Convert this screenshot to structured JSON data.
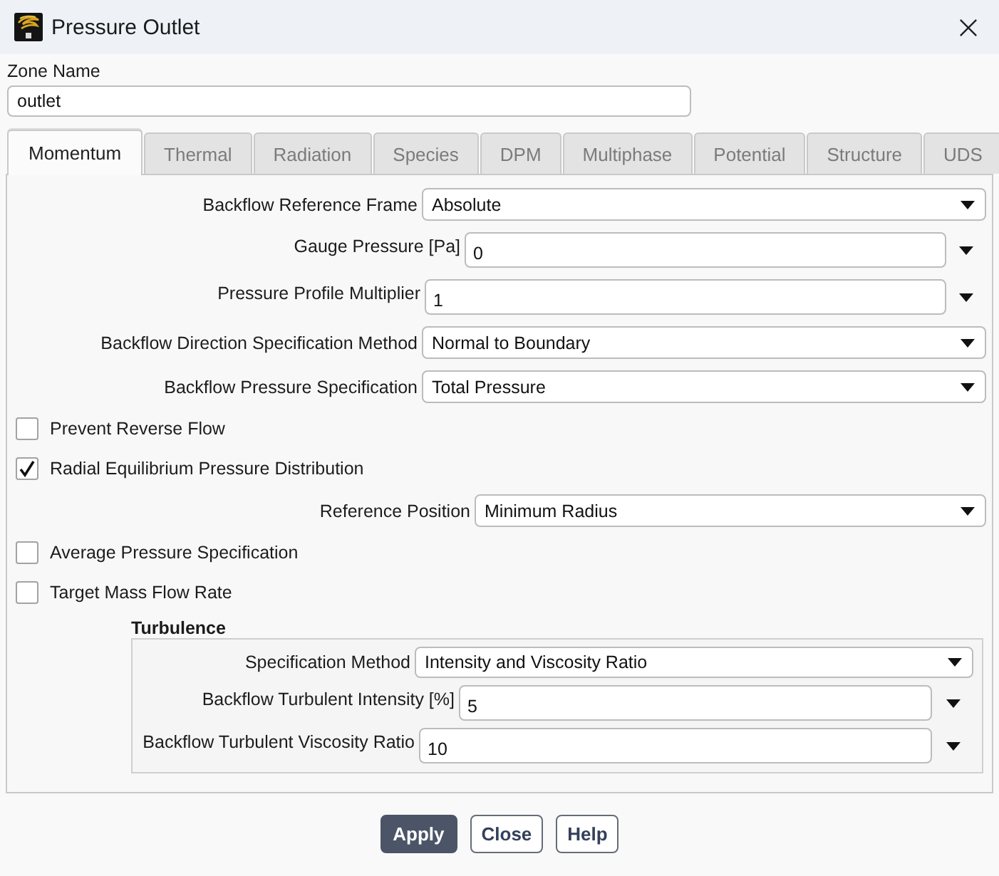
{
  "window": {
    "title": "Pressure Outlet"
  },
  "zone_name": {
    "label": "Zone Name",
    "value": "outlet"
  },
  "tabs": [
    {
      "label": "Momentum",
      "selected": true,
      "disabled": false
    },
    {
      "label": "Thermal",
      "selected": false,
      "disabled": true
    },
    {
      "label": "Radiation",
      "selected": false,
      "disabled": true
    },
    {
      "label": "Species",
      "selected": false,
      "disabled": true
    },
    {
      "label": "DPM",
      "selected": false,
      "disabled": true
    },
    {
      "label": "Multiphase",
      "selected": false,
      "disabled": true
    },
    {
      "label": "Potential",
      "selected": false,
      "disabled": true
    },
    {
      "label": "Structure",
      "selected": false,
      "disabled": true
    },
    {
      "label": "UDS",
      "selected": false,
      "disabled": true
    }
  ],
  "fields": [
    {
      "kind": "dropdown",
      "label": "Backflow Reference Frame",
      "value": "Absolute"
    },
    {
      "kind": "number",
      "label": "Gauge Pressure [Pa]",
      "value": "0"
    },
    {
      "kind": "number",
      "label": "Pressure Profile Multiplier",
      "value": "1"
    },
    {
      "kind": "dropdown",
      "label": "Backflow Direction Specification Method",
      "value": "Normal to Boundary"
    },
    {
      "kind": "dropdown",
      "label": "Backflow Pressure Specification",
      "value": "Total Pressure"
    },
    {
      "kind": "checkbox",
      "label": "Prevent Reverse Flow",
      "checked": false
    },
    {
      "kind": "checkbox",
      "label": "Radial Equilibrium Pressure Distribution",
      "checked": true
    },
    {
      "kind": "dropdown",
      "label": "Reference Position",
      "value": "Minimum Radius"
    },
    {
      "kind": "checkbox",
      "label": "Average Pressure Specification",
      "checked": false
    },
    {
      "kind": "checkbox",
      "label": "Target Mass Flow Rate",
      "checked": false
    }
  ],
  "turbulence": {
    "title": "Turbulence",
    "fields": [
      {
        "kind": "dropdown",
        "label": "Specification Method",
        "value": "Intensity and Viscosity Ratio"
      },
      {
        "kind": "number",
        "label": "Backflow Turbulent Intensity [%]",
        "value": "5"
      },
      {
        "kind": "number",
        "label": "Backflow Turbulent Viscosity Ratio",
        "value": "10"
      }
    ]
  },
  "buttons": [
    {
      "label": "Apply",
      "primary": true
    },
    {
      "label": "Close",
      "primary": false
    },
    {
      "label": "Help",
      "primary": false
    }
  ]
}
